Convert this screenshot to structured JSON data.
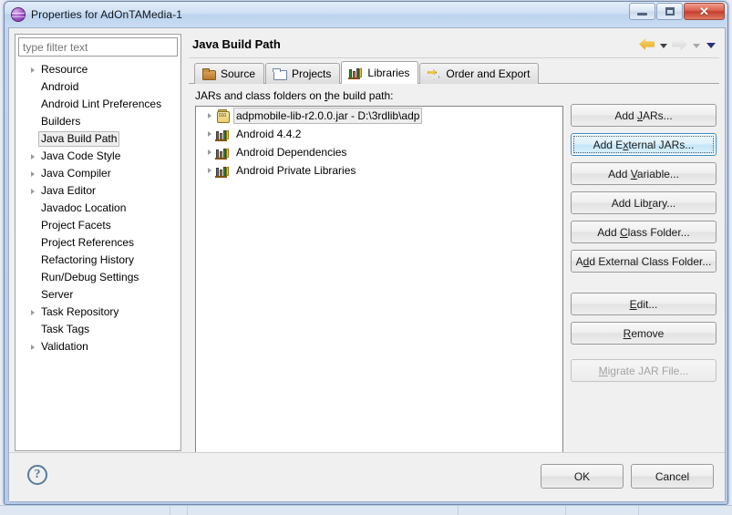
{
  "window": {
    "title": "Properties for AdOnTAMedia-1",
    "app_icon": "purple-sphere-icon",
    "controls": {
      "minimize": "minimize-button",
      "maximize": "maximize-button",
      "close": "✕"
    }
  },
  "sidebar": {
    "filter_placeholder": "type filter text",
    "filter_value": "",
    "items": [
      {
        "label": "Resource",
        "expandable": true,
        "selected": false
      },
      {
        "label": "Android",
        "expandable": false,
        "selected": false
      },
      {
        "label": "Android Lint Preferences",
        "expandable": false,
        "selected": false
      },
      {
        "label": "Builders",
        "expandable": false,
        "selected": false
      },
      {
        "label": "Java Build Path",
        "expandable": false,
        "selected": true
      },
      {
        "label": "Java Code Style",
        "expandable": true,
        "selected": false
      },
      {
        "label": "Java Compiler",
        "expandable": true,
        "selected": false
      },
      {
        "label": "Java Editor",
        "expandable": true,
        "selected": false
      },
      {
        "label": "Javadoc Location",
        "expandable": false,
        "selected": false
      },
      {
        "label": "Project Facets",
        "expandable": false,
        "selected": false
      },
      {
        "label": "Project References",
        "expandable": false,
        "selected": false
      },
      {
        "label": "Refactoring History",
        "expandable": false,
        "selected": false
      },
      {
        "label": "Run/Debug Settings",
        "expandable": false,
        "selected": false
      },
      {
        "label": "Server",
        "expandable": false,
        "selected": false
      },
      {
        "label": "Task Repository",
        "expandable": true,
        "selected": false
      },
      {
        "label": "Task Tags",
        "expandable": false,
        "selected": false
      },
      {
        "label": "Validation",
        "expandable": true,
        "selected": false
      }
    ]
  },
  "content": {
    "page_title": "Java Build Path",
    "nav": {
      "back_icon": "back-arrow-icon",
      "back_menu_icon": "chevron-down-icon",
      "forward_icon": "forward-arrow-icon",
      "forward_menu_icon": "chevron-down-icon",
      "view_menu_icon": "chevron-down-icon"
    },
    "tabs": [
      {
        "label": "Source",
        "icon": "package-icon",
        "active": false
      },
      {
        "label": "Projects",
        "icon": "folder-open-icon",
        "active": false
      },
      {
        "label": "Libraries",
        "icon": "books-icon",
        "active": true
      },
      {
        "label": "Order and Export",
        "icon": "order-arrows-icon",
        "active": false
      }
    ],
    "list_label": "JARs and class folders on the build path:",
    "list_label_mnemonic": "t",
    "entries": [
      {
        "label": "adpmobile-lib-r2.0.0.jar - D:\\3rdlib\\adp",
        "icon": "jar-icon",
        "selected": true,
        "expandable": true
      },
      {
        "label": "Android 4.4.2",
        "icon": "books-icon",
        "selected": false,
        "expandable": true
      },
      {
        "label": "Android Dependencies",
        "icon": "books-icon",
        "selected": false,
        "expandable": true
      },
      {
        "label": "Android Private Libraries",
        "icon": "books-icon",
        "selected": false,
        "expandable": true
      }
    ],
    "buttons": [
      {
        "label": "Add JARs...",
        "mnemonic": "J",
        "state": "normal"
      },
      {
        "label": "Add External JARs...",
        "mnemonic": "x",
        "state": "focused"
      },
      {
        "label": "Add Variable...",
        "mnemonic": "V",
        "state": "normal"
      },
      {
        "label": "Add Library...",
        "mnemonic": "r",
        "state": "normal"
      },
      {
        "label": "Add Class Folder...",
        "mnemonic": "C",
        "state": "normal"
      },
      {
        "label": "Add External Class Folder...",
        "mnemonic": "d",
        "state": "normal"
      },
      {
        "label": "Edit...",
        "mnemonic": "E",
        "state": "normal"
      },
      {
        "label": "Remove",
        "mnemonic": "R",
        "state": "normal"
      },
      {
        "label": "Migrate JAR File...",
        "mnemonic": "M",
        "state": "disabled"
      }
    ]
  },
  "footer": {
    "help_icon": "question-mark-icon",
    "help_glyph": "?",
    "ok_label": "OK",
    "cancel_label": "Cancel"
  },
  "colors": {
    "titlebar": "#c9dcf3",
    "accent_focus": "#3c8dc8",
    "close_button": "#c33e2c",
    "selection_bg": "#eeeeee"
  }
}
